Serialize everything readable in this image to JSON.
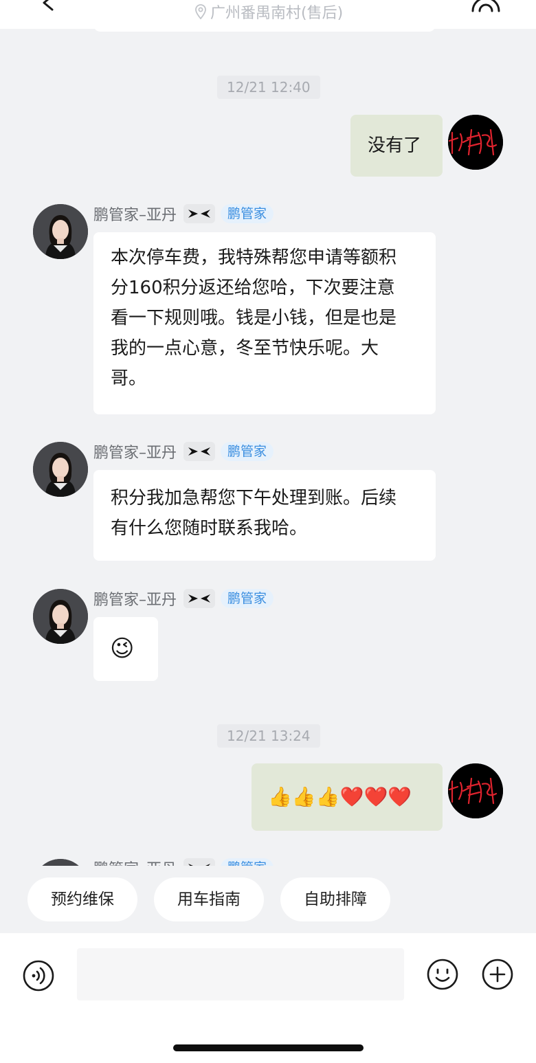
{
  "header": {
    "location": "广州番禺南村(售后)"
  },
  "messages": [
    {
      "type": "timestamp",
      "text": "12/21 12:40"
    },
    {
      "type": "outgoing",
      "text": "没有了"
    },
    {
      "type": "incoming",
      "sender": "鹏管家–亚丹",
      "role_badge": "鹏管家",
      "text": [
        "本次停车费，我特殊帮您申请等额积",
        "分160积分返还给您哈，下次要注意",
        "看一下规则哦。钱是小钱，但是也是",
        "我的一点心意，冬至节快乐呢。大",
        "哥。"
      ]
    },
    {
      "type": "incoming",
      "sender": "鹏管家–亚丹",
      "role_badge": "鹏管家",
      "text": [
        "积分我加急帮您下午处理到账。后续",
        "有什么您随时联系我哈。"
      ]
    },
    {
      "type": "incoming",
      "sender": "鹏管家–亚丹",
      "role_badge": "鹏管家",
      "text": "😉"
    },
    {
      "type": "timestamp",
      "text": "12/21 13:24"
    },
    {
      "type": "outgoing",
      "text": "👍👍👍❤️❤️❤️"
    },
    {
      "type": "incoming",
      "sender": "鹏管家–亚丹",
      "role_badge": "鹏管家"
    }
  ],
  "quick_replies": [
    "预约维保",
    "用车指南",
    "自助排障"
  ],
  "input": {
    "placeholder": ""
  },
  "colors": {
    "outgoing_bubble": "#e2e8d8",
    "incoming_bubble": "#ffffff",
    "badge_blue": "#3a8ee0",
    "background": "#f1f2f4"
  }
}
